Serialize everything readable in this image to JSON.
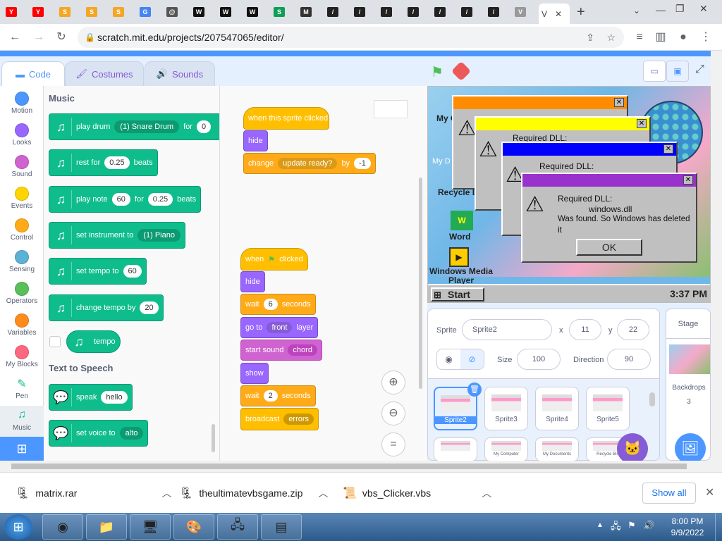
{
  "tabs": [
    {
      "letter": "Y",
      "color": "#ff0000"
    },
    {
      "letter": "Y",
      "color": "#ff0000"
    },
    {
      "letter": "S",
      "color": "#f5a623"
    },
    {
      "letter": "S",
      "color": "#f5a623"
    },
    {
      "letter": "S",
      "color": "#f5a623"
    },
    {
      "letter": "G",
      "color": "#4285f4"
    },
    {
      "letter": "@",
      "color": "#555555"
    },
    {
      "letter": "W",
      "color": "#111111"
    },
    {
      "letter": "W",
      "color": "#111111"
    },
    {
      "letter": "W",
      "color": "#111111"
    },
    {
      "letter": "S",
      "color": "#0f9d58"
    },
    {
      "letter": "M",
      "color": "#333333"
    },
    {
      "letter": "/",
      "color": "#222222"
    },
    {
      "letter": "/",
      "color": "#222222"
    },
    {
      "letter": "/",
      "color": "#222222"
    },
    {
      "letter": "/",
      "color": "#222222"
    },
    {
      "letter": "/",
      "color": "#222222"
    },
    {
      "letter": "/",
      "color": "#222222"
    },
    {
      "letter": "/",
      "color": "#222222"
    },
    {
      "letter": "V",
      "color": "#999999"
    }
  ],
  "active_tab": {
    "title": "V",
    "close": "✕"
  },
  "new_tab": "+",
  "url": "scratch.mit.edu/projects/207547065/editor/",
  "editor_tabs": {
    "code": "Code",
    "costumes": "Costumes",
    "sounds": "Sounds"
  },
  "categories": [
    {
      "label": "Motion",
      "color": "#4c97ff"
    },
    {
      "label": "Looks",
      "color": "#9966ff"
    },
    {
      "label": "Sound",
      "color": "#cf63cf"
    },
    {
      "label": "Events",
      "color": "#ffd500"
    },
    {
      "label": "Control",
      "color": "#ffab19"
    },
    {
      "label": "Sensing",
      "color": "#5cb1d6"
    },
    {
      "label": "Operators",
      "color": "#59c059"
    },
    {
      "label": "Variables",
      "color": "#ff8c1a"
    },
    {
      "label": "My Blocks",
      "color": "#ff6680"
    },
    {
      "label": "Pen",
      "color": "#0fbd8c"
    },
    {
      "label": "Music",
      "color": "#0fbd8c"
    }
  ],
  "palette": {
    "music_heading": "Music",
    "tts_heading": "Text to Speech",
    "play_drum": {
      "a": "play drum",
      "b": "(1) Snare Drum",
      "c": "for",
      "d": "0"
    },
    "rest": {
      "a": "rest for",
      "b": "0.25",
      "c": "beats"
    },
    "play_note": {
      "a": "play note",
      "b": "60",
      "c": "for",
      "d": "0.25",
      "e": "beats"
    },
    "instrument": {
      "a": "set instrument to",
      "b": "(1) Piano"
    },
    "tempo_set": {
      "a": "set tempo to",
      "b": "60"
    },
    "tempo_change": {
      "a": "change tempo by",
      "b": "20"
    },
    "tempo": "tempo",
    "speak": {
      "a": "speak",
      "b": "hello"
    },
    "voice": {
      "a": "set voice to",
      "b": "alto"
    }
  },
  "script1": {
    "hat": "when this sprite clicked",
    "hide": "hide",
    "change": "change",
    "effect": "update ready?",
    "by": "by",
    "val": "-1"
  },
  "script2": {
    "when": "when",
    "clicked": "clicked",
    "hide": "hide",
    "wait1": {
      "a": "wait",
      "b": "6",
      "c": "seconds"
    },
    "goto": {
      "a": "go to",
      "b": "front",
      "c": "layer"
    },
    "sound": {
      "a": "start sound",
      "b": "chord"
    },
    "show": "show",
    "wait2": {
      "a": "wait",
      "b": "2",
      "c": "seconds"
    },
    "broadcast": {
      "a": "broadcast",
      "b": "errors"
    }
  },
  "stage_windows": {
    "w1": {
      "title_color": "#ff8c00"
    },
    "w2": {
      "title_color": "#ffff00",
      "text": "Required DLL:"
    },
    "w3": {
      "title_color": "#0000ff",
      "text": "Required DLL:"
    },
    "w4": {
      "title_color": "#9932cc",
      "line1": "Required DLL:",
      "line2": "windows.dll",
      "line3": "Was found. So Windows has deleted",
      "line4": "it",
      "ok": "OK"
    }
  },
  "stage_labels": {
    "myc": "My C",
    "myd": "My D",
    "recycle": "Recycle B",
    "word": "Word",
    "wmp": "Windows Media Player",
    "start": "Start",
    "clock": "3:37 PM"
  },
  "sprite_info": {
    "sprite_label": "Sprite",
    "name": "Sprite2",
    "x_label": "x",
    "x": "11",
    "y_label": "y",
    "y": "22",
    "size_label": "Size",
    "size": "100",
    "dir_label": "Direction",
    "dir": "90"
  },
  "sprites": [
    "Sprite2",
    "Sprite3",
    "Sprite4",
    "Sprite5",
    "",
    "My Computer",
    "My Documents",
    "Recycle Bin"
  ],
  "stage_panel": {
    "title": "Stage",
    "backdrops": "Backdrops",
    "count": "3"
  },
  "downloads": [
    {
      "name": "matrix.rar"
    },
    {
      "name": "theultimatevbsgame.zip"
    },
    {
      "name": "vbs_Clicker.vbs"
    }
  ],
  "show_all": "Show all",
  "clock": {
    "time": "8:00 PM",
    "date": "9/9/2022"
  }
}
